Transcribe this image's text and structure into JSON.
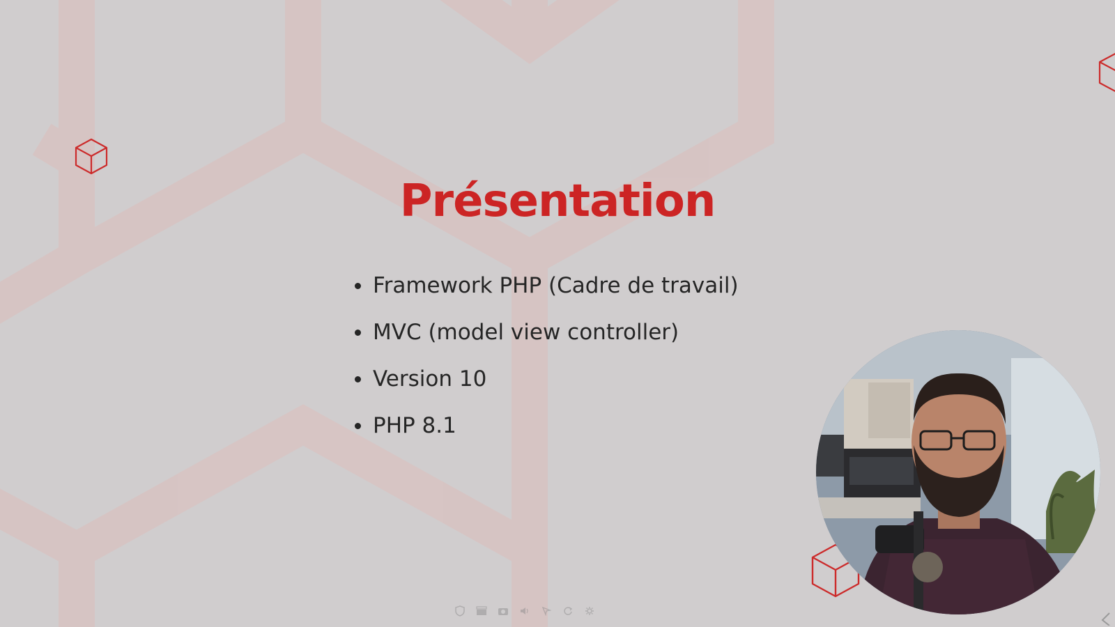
{
  "slide": {
    "title": "Présentation",
    "bullets": [
      "Framework PHP (Cadre de travail)",
      "MVC (model view controller)",
      "Version 10",
      "PHP 8.1"
    ]
  },
  "colors": {
    "background": "#d0cdce",
    "hex_pattern": "#d9c2c1",
    "accent_red": "#cc2424",
    "body_text": "#252525"
  },
  "icons": {
    "decorations": [
      "cube-icon"
    ],
    "controls": [
      "shield-icon",
      "clapperboard-icon",
      "camera-icon",
      "speaker-icon",
      "pointer-icon",
      "refresh-icon",
      "settings-icon"
    ],
    "navigation": [
      "chevron-left-icon"
    ]
  },
  "webcam": {
    "shape": "circle"
  }
}
